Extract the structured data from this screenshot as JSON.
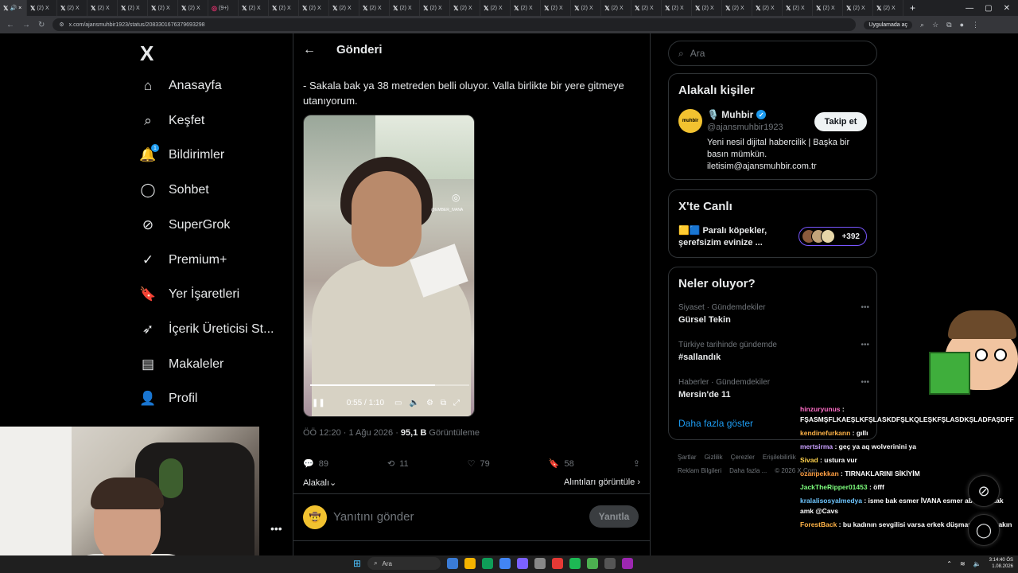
{
  "browser": {
    "tab_label": "(2) X",
    "tab_count_label": "(9+)",
    "active_tab_label": "",
    "url": "x.com/ajansmuhbir1923/status/2083301676379693298",
    "open_app_label": "Uygulamada aç"
  },
  "nav": {
    "logo": "X",
    "items": [
      {
        "label": "Anasayfa",
        "icon": "home-icon"
      },
      {
        "label": "Keşfet",
        "icon": "search-icon"
      },
      {
        "label": "Bildirimler",
        "icon": "bell-icon",
        "badge": "1"
      },
      {
        "label": "Sohbet",
        "icon": "chat-icon"
      },
      {
        "label": "SuperGrok",
        "icon": "grok-icon"
      },
      {
        "label": "Premium+",
        "icon": "premium-icon"
      },
      {
        "label": "Yer İşaretleri",
        "icon": "bookmark-icon"
      },
      {
        "label": "İçerik Üreticisi St...",
        "icon": "rocket-icon"
      },
      {
        "label": "Makaleler",
        "icon": "article-icon"
      },
      {
        "label": "Profil",
        "icon": "profile-icon"
      }
    ]
  },
  "post": {
    "header_title": "Gönderi",
    "text": "- Sakala bak ya 38 metreden belli oluyor. Valla birlikte bir yere gitmeye utanıyorum.",
    "video": {
      "time": "0:55 / 1:10",
      "watermark": "@EMBER_IVANA",
      "progress": 0.786
    },
    "meta_time": "ÖÖ 12:20 · 1 Ağu 2026 · ",
    "views": "95,1 B",
    "views_label": " Görüntüleme",
    "replies": "89",
    "reposts": "11",
    "likes": "79",
    "bookmarks": "58",
    "related_label": "Alakalı",
    "quotes_label": "Alıntıları görüntüle",
    "reply_placeholder": "Yanıtını gönder",
    "reply_button": "Yanıtla"
  },
  "sidebar": {
    "search_placeholder": "Ara",
    "related_title": "Alakalı kişiler",
    "account": {
      "avatar_text": "muhbir",
      "name": "🎙️ Muhbir",
      "handle": "@ajansmuhbir1923",
      "follow": "Takip et",
      "bio": "Yeni nesil dijital habercilik | Başka bir basın mümkün. iletisim@ajansmuhbir.com.tr"
    },
    "live_title": "X'te Canlı",
    "live_text": "🟨🟦 Paralı köpekler, şerefsizim evinize ...",
    "live_count": "+392",
    "trends_title": "Neler oluyor?",
    "trends": [
      {
        "category": "Siyaset · Gündemdekiler",
        "name": "Gürsel Tekin"
      },
      {
        "category": "Türkiye tarihinde gündemde",
        "name": "#sallandık"
      },
      {
        "category": "Haberler · Gündemdekiler",
        "name": "Mersin'de 11"
      }
    ],
    "show_more": "Daha fazla göster",
    "footer": [
      "Şartlar",
      "Gizlilik",
      "Çerezler",
      "Erişilebilirlik",
      "Reklam Bilgileri",
      "Daha fazla ...",
      "© 2026 X Corp."
    ]
  },
  "chat": [
    {
      "user": "hinzuryunus",
      "color": "#ff6ec7",
      "text": "FŞASMŞFLKAEŞLKFŞLASKDFŞLKQLEŞKFŞLASDKŞLADFAŞDFF"
    },
    {
      "user": "kendinefurkann",
      "color": "#ffb347",
      "text": "gıllı"
    },
    {
      "user": "mertsirma",
      "color": "#c9a0ff",
      "text": "geç ya aq wolverinini ya"
    },
    {
      "user": "Sivad",
      "color": "#ffd24d",
      "text": "ustura vur"
    },
    {
      "user": "ozanpekkan",
      "color": "#ff9f43",
      "text": "TIRNAKLARINI SİKİYİM"
    },
    {
      "user": "JackTheRipper01453",
      "color": "#7dff7d",
      "text": "öfff"
    },
    {
      "user": "kralalisosyalmedya",
      "color": "#6ec6ff",
      "text": "isme bak esmer İVANA esmer abdulrezzak amk @Cavs"
    },
    {
      "user": "ForestBack",
      "color": "#ffb347",
      "text": "bu kadının sevgilisi varsa erkek düşmanlığını bırakın"
    }
  ],
  "taskbar": {
    "search": "Ara",
    "time": "3:14:40 ÖS",
    "date": "1.08.2026"
  },
  "colors": {
    "accent": "#1d9bf0",
    "background": "#000000",
    "border": "#2f3336"
  }
}
